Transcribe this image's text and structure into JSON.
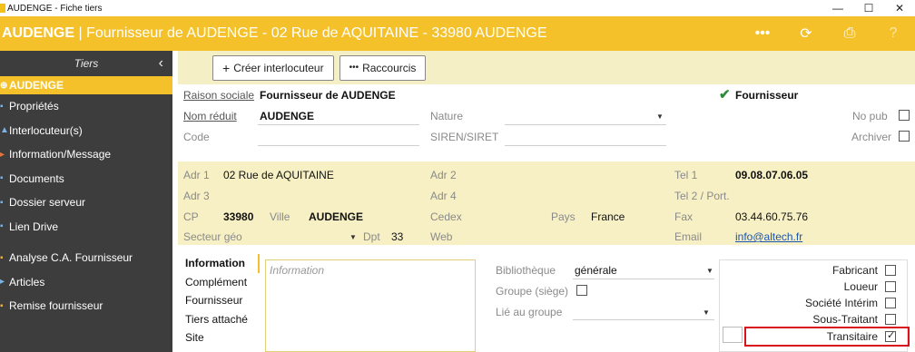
{
  "window": {
    "title": "AUDENGE - Fiche tiers",
    "controls": [
      "—",
      "☐",
      "✕"
    ]
  },
  "header": {
    "bold": "AUDENGE",
    "rest": " | Fournisseur de AUDENGE - 02 Rue de AQUITAINE - 33980 AUDENGE",
    "icons": [
      "more-icon",
      "refresh-icon",
      "print-icon",
      "help-icon"
    ]
  },
  "sidebar": {
    "title": "Tiers",
    "collapse": "‹",
    "items": [
      {
        "label": "AUDENGE",
        "icon": "⊕"
      },
      {
        "label": "Propriétés",
        "icon": "▪"
      },
      {
        "label": "Interlocuteur(s)",
        "icon": "▲"
      },
      {
        "label": "Information/Message",
        "icon": "▸"
      },
      {
        "label": "Documents",
        "icon": "▪"
      },
      {
        "label": "Dossier serveur",
        "icon": "▪"
      },
      {
        "label": "Lien Drive",
        "icon": "▪"
      },
      {
        "label": "Analyse C.A. Fournisseur",
        "icon": "▪"
      },
      {
        "label": "Articles",
        "icon": "▸"
      },
      {
        "label": "Remise fournisseur",
        "icon": "▪"
      }
    ]
  },
  "toolbar": {
    "create_contact": "Créer interlocuteur",
    "shortcuts": "Raccourcis"
  },
  "identity": {
    "raison_sociale_label": "Raison sociale",
    "raison_sociale": "Fournisseur de AUDENGE",
    "supplier_flag": "Fournisseur",
    "nom_reduit_label": "Nom réduit",
    "nom_reduit": "AUDENGE",
    "nature_label": "Nature",
    "nature": "",
    "no_pub_label": "No pub",
    "code_label": "Code",
    "code": "",
    "siren_label": "SIREN/SIRET",
    "siren": "",
    "archiver_label": "Archiver"
  },
  "address": {
    "adr1_label": "Adr 1",
    "adr1": "02 Rue de AQUITAINE",
    "adr2_label": "Adr 2",
    "adr3_label": "Adr 3",
    "adr4_label": "Adr 4",
    "tel1_label": "Tel 1",
    "tel1": "09.08.07.06.05",
    "tel2_label": "Tel 2 / Port.",
    "cp_label": "CP",
    "cp": "33980",
    "ville_label": "Ville",
    "ville": "AUDENGE",
    "cedex_label": "Cedex",
    "pays_label": "Pays",
    "pays": "France",
    "fax_label": "Fax",
    "fax": "03.44.60.75.76",
    "secteur_label": "Secteur géo",
    "dpt_label": "Dpt",
    "dpt": "33",
    "web_label": "Web",
    "email_label": "Email",
    "email": "info@altech.fr"
  },
  "tabs": [
    "Information",
    "Complément",
    "Fournisseur",
    "Tiers attaché",
    "Site"
  ],
  "info_placeholder": "Information",
  "library": {
    "bibliotheque_label": "Bibliothèque",
    "bibliotheque": "générale",
    "groupe_label": "Groupe (siège)",
    "lie_label": "Lié au groupe",
    "lie": ""
  },
  "roles": [
    {
      "label": "Fabricant",
      "checked": false
    },
    {
      "label": "Loueur",
      "checked": false
    },
    {
      "label": "Société Intérim",
      "checked": false
    },
    {
      "label": "Sous-Traitant",
      "checked": false
    },
    {
      "label": "Transitaire",
      "checked": true
    }
  ],
  "colors": {
    "accent": "#f5c12b",
    "sidebar": "#3d3d3d",
    "highlight": "#d9121b",
    "panel": "#f7f0c4"
  }
}
